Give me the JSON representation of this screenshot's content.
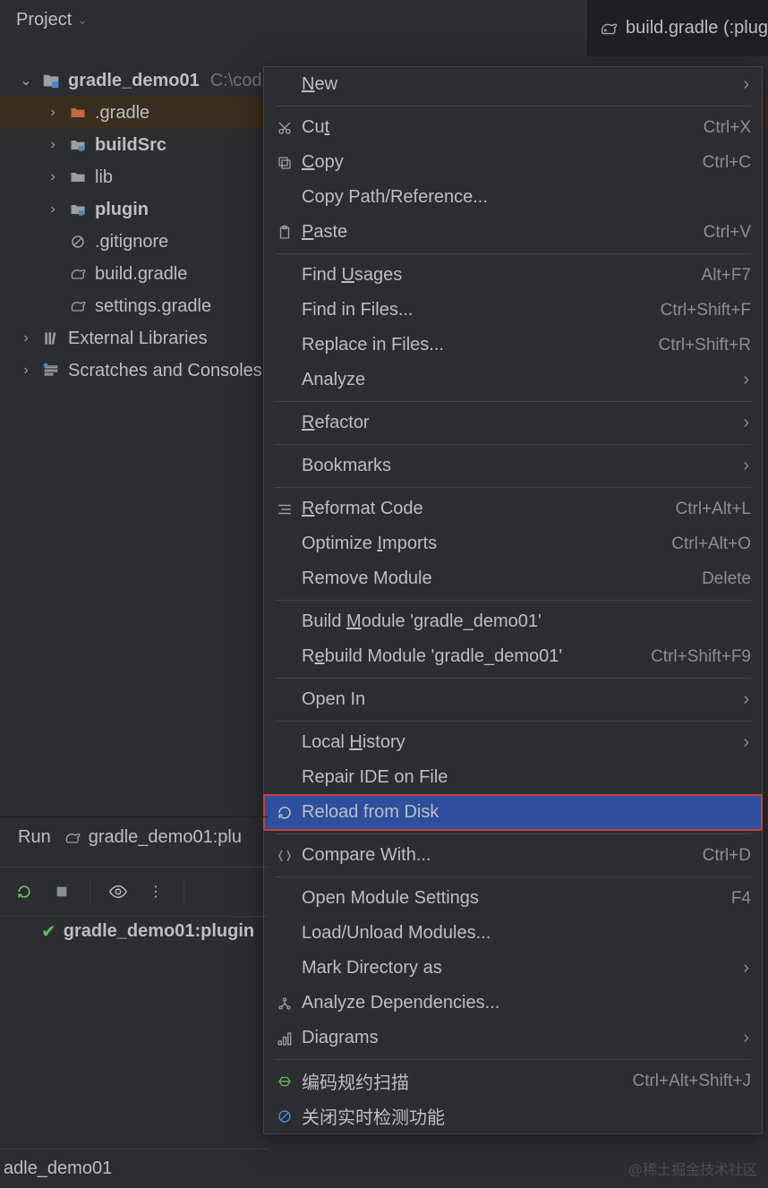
{
  "header": {
    "project_label": "Project",
    "tab_label": "build.gradle (:plug"
  },
  "tree": {
    "root": {
      "name": "gradle_demo01",
      "path": "C:\\cod"
    },
    "items": [
      {
        "name": ".gradle",
        "type": "closed-folder",
        "selected": true
      },
      {
        "name": "buildSrc",
        "type": "module-folder"
      },
      {
        "name": "lib",
        "type": "folder"
      },
      {
        "name": "plugin",
        "type": "module-folder"
      },
      {
        "name": ".gitignore",
        "type": "ignore"
      },
      {
        "name": "build.gradle",
        "type": "gradle"
      },
      {
        "name": "settings.gradle",
        "type": "gradle"
      }
    ],
    "external": "External Libraries",
    "scratches": "Scratches and Consoles"
  },
  "context_menu": {
    "groups": [
      [
        {
          "label": "New",
          "mn": 0,
          "sub": true
        }
      ],
      [
        {
          "label": "Cut",
          "icon": "cut",
          "mn": 2,
          "short": "Ctrl+X"
        },
        {
          "label": "Copy",
          "icon": "copy",
          "mn": 0,
          "short": "Ctrl+C"
        },
        {
          "label": "Copy Path/Reference..."
        },
        {
          "label": "Paste",
          "icon": "paste",
          "mn": 0,
          "short": "Ctrl+V"
        }
      ],
      [
        {
          "label": "Find Usages",
          "mn": 5,
          "short": "Alt+F7"
        },
        {
          "label": "Find in Files...",
          "short": "Ctrl+Shift+F"
        },
        {
          "label": "Replace in Files...",
          "short": "Ctrl+Shift+R"
        },
        {
          "label": "Analyze",
          "sub": true
        }
      ],
      [
        {
          "label": "Refactor",
          "mn": 0,
          "sub": true
        }
      ],
      [
        {
          "label": "Bookmarks",
          "sub": true
        }
      ],
      [
        {
          "label": "Reformat Code",
          "icon": "reformat",
          "mn": 0,
          "short": "Ctrl+Alt+L"
        },
        {
          "label": "Optimize Imports",
          "mn": 9,
          "short": "Ctrl+Alt+O"
        },
        {
          "label": "Remove Module",
          "short": "Delete"
        }
      ],
      [
        {
          "label": "Build Module 'gradle_demo01'",
          "mn": 6
        },
        {
          "label": "Rebuild Module 'gradle_demo01'",
          "mn": 1,
          "short": "Ctrl+Shift+F9"
        }
      ],
      [
        {
          "label": "Open In",
          "sub": true
        }
      ],
      [
        {
          "label": "Local History",
          "mn": 6,
          "sub": true
        },
        {
          "label": "Repair IDE on File"
        },
        {
          "label": "Reload from Disk",
          "icon": "reload",
          "selected": true
        }
      ],
      [
        {
          "label": "Compare With...",
          "icon": "compare",
          "short": "Ctrl+D"
        }
      ],
      [
        {
          "label": "Open Module Settings",
          "short": "F4"
        },
        {
          "label": "Load/Unload Modules..."
        },
        {
          "label": "Mark Directory as",
          "sub": true
        },
        {
          "label": "Analyze Dependencies...",
          "icon": "analyze-deps"
        },
        {
          "label": "Diagrams",
          "icon": "diagram",
          "sub": true
        }
      ],
      [
        {
          "label": "编码规约扫描",
          "icon": "scan",
          "short": "Ctrl+Alt+Shift+J"
        },
        {
          "label": "关闭实时检测功能",
          "icon": "forbid"
        }
      ]
    ]
  },
  "run": {
    "tab": "Run",
    "task": "gradle_demo01:plu",
    "result": "gradle_demo01:plugin"
  },
  "status_bar": "adle_demo01",
  "watermark": "@稀土掘金技术社区"
}
